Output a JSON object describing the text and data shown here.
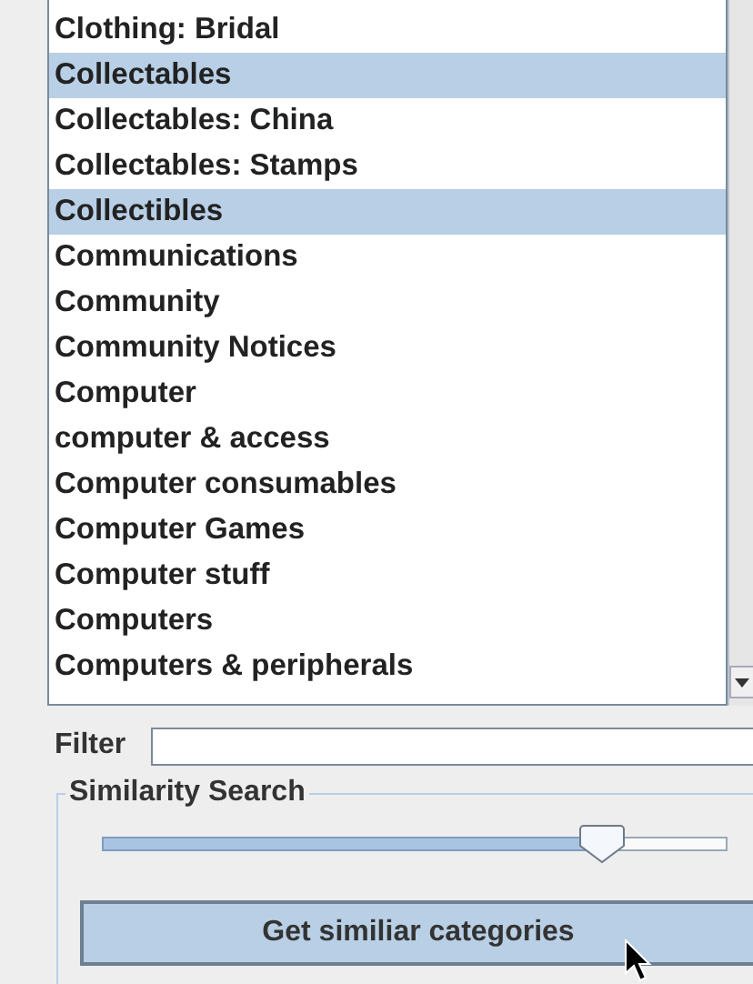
{
  "category_list": {
    "items": [
      {
        "label": "Clothing: Bridal",
        "selected": false
      },
      {
        "label": "Collectables",
        "selected": true
      },
      {
        "label": "Collectables: China",
        "selected": false
      },
      {
        "label": "Collectables: Stamps",
        "selected": false
      },
      {
        "label": "Collectibles",
        "selected": true
      },
      {
        "label": "Communications",
        "selected": false
      },
      {
        "label": "Community",
        "selected": false
      },
      {
        "label": "Community Notices",
        "selected": false
      },
      {
        "label": "Computer",
        "selected": false
      },
      {
        "label": "computer & access",
        "selected": false
      },
      {
        "label": "Computer consumables",
        "selected": false
      },
      {
        "label": "Computer Games",
        "selected": false
      },
      {
        "label": "Computer stuff",
        "selected": false
      },
      {
        "label": "Computers",
        "selected": false
      },
      {
        "label": "Computers & peripherals",
        "selected": false
      }
    ]
  },
  "filter": {
    "label": "Filter"
  },
  "similarity_search": {
    "title": "Similarity Search",
    "slider": {
      "level": 0.8
    },
    "button": "Get similiar categories"
  }
}
